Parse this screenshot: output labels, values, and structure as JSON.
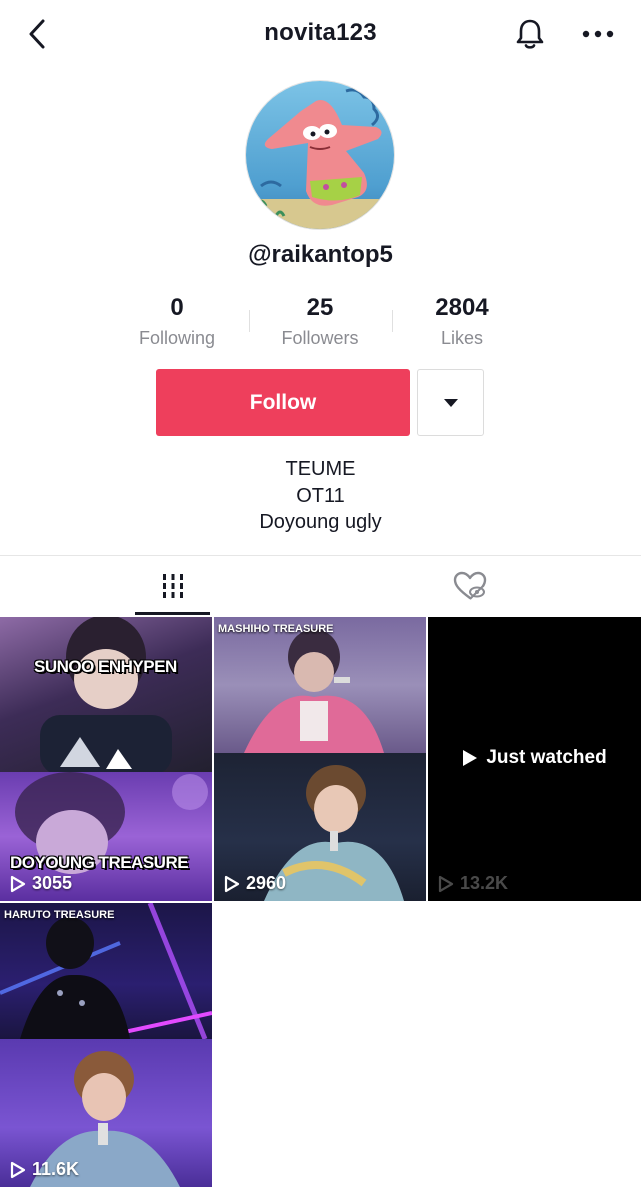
{
  "header": {
    "title": "novita123"
  },
  "profile": {
    "handle": "@raikantop5",
    "stats": [
      {
        "value": "0",
        "label": "Following"
      },
      {
        "value": "25",
        "label": "Followers"
      },
      {
        "value": "2804",
        "label": "Likes"
      }
    ],
    "follow_label": "Follow",
    "bio": [
      "TEUME",
      "OT11",
      "Doyoung ugly"
    ]
  },
  "colors": {
    "accent": "#ee3f5c",
    "text": "#161823",
    "muted": "#8a8b91"
  },
  "tabs": [
    {
      "icon": "videos-grid-icon",
      "active": true
    },
    {
      "icon": "liked-heart-icon",
      "active": false
    }
  ],
  "videos": [
    {
      "caption_top": "SUNOO ENHYPEN",
      "caption_bottom": "DOYOUNG TREASURE",
      "views": "3055"
    },
    {
      "caption_top": "MASHIHO TREASURE",
      "views": "2960"
    },
    {
      "overlay": "Just watched",
      "views": "13.2K"
    },
    {
      "caption_top": "HARUTO TREASURE",
      "views": "11.6K"
    }
  ]
}
